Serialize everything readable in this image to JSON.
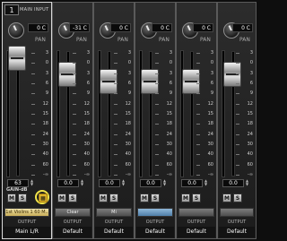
{
  "main": {
    "input_number": "1",
    "input_label": "MAIN INPUT",
    "pan_value": "0 C",
    "pan_label": "PAN",
    "gain_value": "63",
    "gain_label": "GAIN-dB",
    "mute_label": "M",
    "solo_label": "S",
    "cue_label": "1st Violins 1 60 M..",
    "output_label": "OUTPUT",
    "output_value": "Main L/R",
    "fader_level_db": 0
  },
  "channels": [
    {
      "pan_value": "-31 C",
      "pan_label": "PAN",
      "gain_value": "0.0",
      "mute_label": "M",
      "solo_label": "S",
      "cue_label": "Clear",
      "output_label": "OUTPUT",
      "output_value": "Default",
      "fader_level_db": -8
    },
    {
      "pan_value": "0 C",
      "pan_label": "PAN",
      "gain_value": "0.0",
      "mute_label": "M",
      "solo_label": "S",
      "cue_label": "Mi",
      "output_label": "OUTPUT",
      "output_value": "Default",
      "fader_level_db": -12
    },
    {
      "pan_value": "0 C",
      "pan_label": "PAN",
      "gain_value": "0.0",
      "mute_label": "M",
      "solo_label": "S",
      "cue_label": "",
      "output_label": "OUTPUT",
      "output_value": "Default",
      "fader_level_db": -12
    },
    {
      "pan_value": "0 C",
      "pan_label": "PAN",
      "gain_value": "0.0",
      "mute_label": "M",
      "solo_label": "S",
      "cue_label": "",
      "output_label": "OUTPUT",
      "output_value": "Default",
      "fader_level_db": -12
    },
    {
      "pan_value": "0 C",
      "pan_label": "PAN",
      "gain_value": "0.0",
      "mute_label": "M",
      "solo_label": "S",
      "cue_label": "",
      "output_label": "OUTPUT",
      "output_value": "Default",
      "fader_level_db": -8
    }
  ],
  "scale_ticks": [
    "3",
    "0",
    "3",
    "6",
    "9",
    "12",
    "15",
    "18",
    "24",
    "30",
    "40",
    "60",
    "-∞"
  ],
  "colors": {
    "link_active": "#e0b52a",
    "highlight_ring": "#f2e54a",
    "strip_bg": "#242424"
  },
  "icons": {
    "link": "link-icon",
    "knob": "pan-knob-icon"
  }
}
